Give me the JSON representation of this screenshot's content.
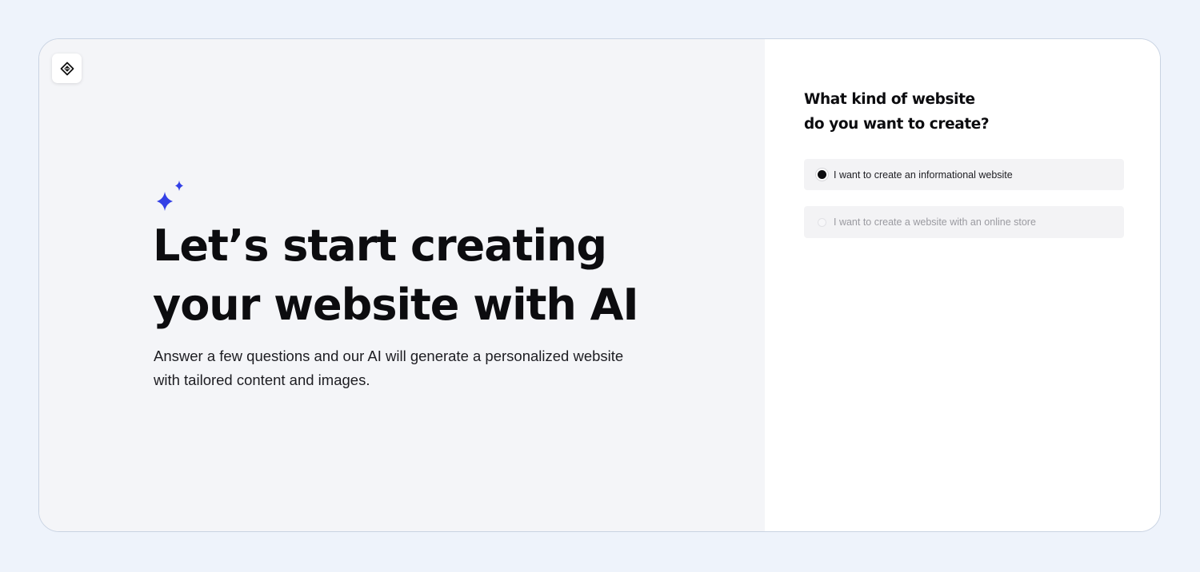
{
  "hero": {
    "title_line1": "Let’s start creating",
    "title_line2": "your website with AI",
    "subtitle_line1": "Answer a few questions and our AI will generate a personalized website",
    "subtitle_line2": "with tailored content and images."
  },
  "logo": {
    "icon": "diamond-logo-icon"
  },
  "sparkle": {
    "icon": "sparkle-icon",
    "color": "#3340e6"
  },
  "form": {
    "question_line1": "What kind of website",
    "question_line2": "do you want to create?",
    "options": [
      {
        "label": "I want to create an informational website",
        "selected": true
      },
      {
        "label": "I want to create a website with an online store",
        "selected": false
      }
    ]
  }
}
